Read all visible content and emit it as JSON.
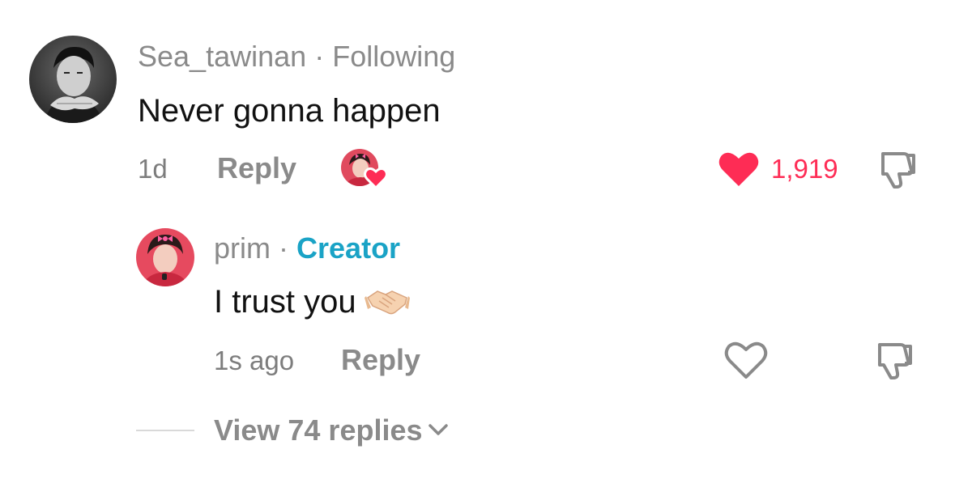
{
  "colors": {
    "muted_text": "#8a8a8a",
    "like_red": "#fe2c55",
    "creator_blue": "#1aa3c6",
    "body_text": "#111111"
  },
  "comment": {
    "username": "Sea_tawinan",
    "separator": "·",
    "relation": "Following",
    "text": "Never gonna happen",
    "time": "1d",
    "reply_label": "Reply",
    "creator_liked_icon": "creator-liked-heart-icon",
    "like_icon": "heart-filled-icon",
    "like_count": "1,919",
    "dislike_icon": "thumbs-down-icon"
  },
  "reply": {
    "username": "prim",
    "separator": "·",
    "tag": "Creator",
    "text": "I trust you",
    "emoji": "handshake-emoji",
    "time": "1s ago",
    "reply_label": "Reply",
    "like_icon": "heart-outline-icon",
    "dislike_icon": "thumbs-down-icon"
  },
  "view_replies": {
    "label": "View 74 replies",
    "icon": "chevron-down-icon"
  }
}
